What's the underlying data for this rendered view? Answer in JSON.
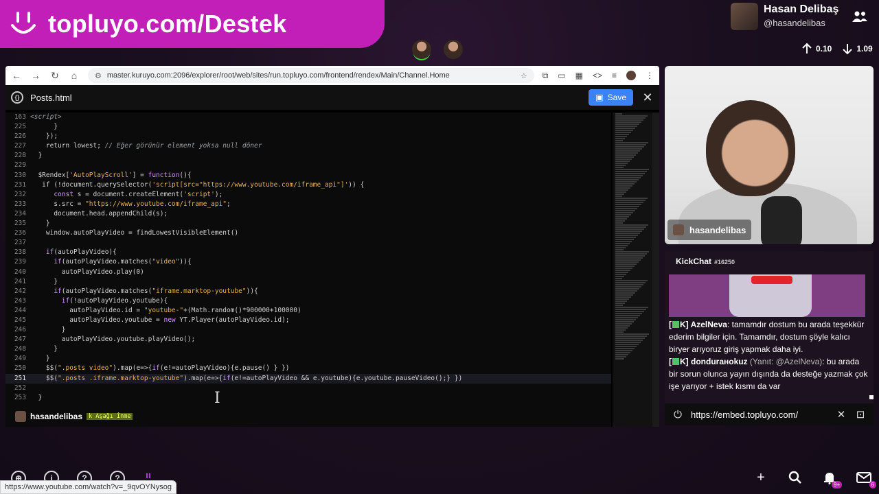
{
  "brand": {
    "text": "topluyo.com/Destek"
  },
  "profile": {
    "name": "Hasan Delibaş",
    "handle": "@hasandelibas"
  },
  "network": {
    "up": "0.10",
    "down": "1.09"
  },
  "browser": {
    "url": "master.kuruyo.com:2096/explorer/root/web/sites/run.topluyo.com/frontend/rendex/Main/Channel.Home"
  },
  "editor": {
    "file_name": "Posts.html",
    "save_label": "Save",
    "lines": [
      {
        "n": "163",
        "html": "&lt;script&gt;",
        "cls": "c"
      },
      {
        "n": "225",
        "html": "      }"
      },
      {
        "n": "226",
        "html": "    });"
      },
      {
        "n": "227",
        "html": "    return lowest; <span class=\"c\">// Eğer görünür element yoksa null döner</span>"
      },
      {
        "n": "228",
        "html": "  }"
      },
      {
        "n": "229",
        "html": ""
      },
      {
        "n": "230",
        "html": "  $Rendex[<span class=\"s\">'AutoPlayScroll'</span>] = <span class=\"k\">function</span>(){"
      },
      {
        "n": "231",
        "html": "   if (!document.querySelector(<span class=\"s\">'script[src=\"https://www.youtube.com/iframe_api\"]'</span>)) {"
      },
      {
        "n": "232",
        "html": "      <span class=\"k\">const</span> s = document.createElement(<span class=\"s\">'script'</span>);"
      },
      {
        "n": "233",
        "html": "      s.src = <span class=\"s\">\"https://www.youtube.com/iframe_api\"</span>;"
      },
      {
        "n": "234",
        "html": "      document.head.appendChild(s);"
      },
      {
        "n": "235",
        "html": "    }"
      },
      {
        "n": "236",
        "html": "    window.autoPlayVideo = findLowestVisibleElement()"
      },
      {
        "n": "237",
        "html": ""
      },
      {
        "n": "238",
        "html": "    <span class=\"k\">if</span>(autoPlayVideo){"
      },
      {
        "n": "239",
        "html": "      <span class=\"k\">if</span>(autoPlayVideo.matches(<span class=\"s\">\"video\"</span>)){"
      },
      {
        "n": "240",
        "html": "        autoPlayVideo.play(0)"
      },
      {
        "n": "241",
        "html": "      }"
      },
      {
        "n": "242",
        "html": "      <span class=\"k\">if</span>(autoPlayVideo.matches(<span class=\"s\">\"iframe.marktop-youtube\"</span>)){"
      },
      {
        "n": "243",
        "html": "        <span class=\"k\">if</span>(!autoPlayVideo.youtube){"
      },
      {
        "n": "244",
        "html": "          autoPlayVideo.id = <span class=\"s\">\"youtube-\"</span>+(Math.random()*900000+100000)"
      },
      {
        "n": "245",
        "html": "          autoPlayVideo.youtube = <span class=\"k\">new</span> YT.Player(autoPlayVideo.id);"
      },
      {
        "n": "246",
        "html": "        }"
      },
      {
        "n": "247",
        "html": "        autoPlayVideo.youtube.playVideo();"
      },
      {
        "n": "248",
        "html": "      }"
      },
      {
        "n": "249",
        "html": "    }"
      },
      {
        "n": "250",
        "html": "    $$(<span class=\"s\">\".posts video\"</span>).map(e=&gt;{<span class=\"k\">if</span>(e!=autoPlayVideo){e.pause() } })"
      },
      {
        "n": "251",
        "html": "    $$(<span class=\"s\">\".posts .iframe.marktop-youtube\"</span>).map(e=&gt;{<span class=\"k\">if</span>(e!=autoPlayVideo &amp;&amp; e.youtube){e.youtube.pauseVideo();} })",
        "active": true
      },
      {
        "n": "252",
        "html": ""
      },
      {
        "n": "253",
        "html": "  }"
      }
    ]
  },
  "caption": {
    "name": "hasandelibas",
    "hint": "k Aşağı İnme"
  },
  "webcam": {
    "name": "hasandelibas"
  },
  "chat": {
    "title": "KickChat",
    "id": "#16250",
    "messages": [
      {
        "badge": "K",
        "user": "AzelNeva",
        "reply": "",
        "text": ": tamamdır dostum bu arada teşekkür ederim bilgiler için. Tamamdır, dostum şöyle kalıcı biryer arıyoruz giriş yapmak daha iyi."
      },
      {
        "badge": "K",
        "user": "dondurанokuz",
        "reply": "(Yanıt: @AzelNeva)",
        "text": ": bu arada bir sorun olunca yayın dışında da desteğe yazmak çok işe yarıyor + istek kısmı da var"
      }
    ],
    "embed_url": "https://embed.topluyo.com/"
  },
  "status_url": "https://www.youtube.com/watch?v=_9qvOYNysog",
  "notifications_count": "9+",
  "messages_count": "6"
}
